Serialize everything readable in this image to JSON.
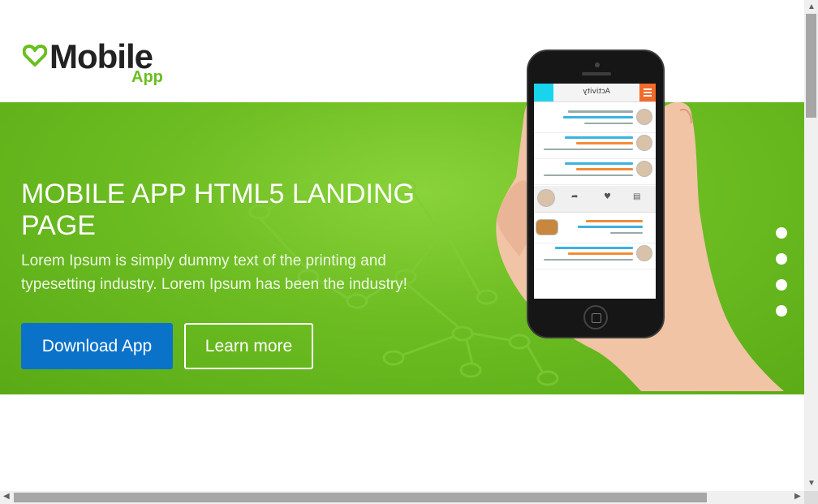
{
  "brand": {
    "name": "Mobile",
    "sub": "App",
    "accent": "#6abf1f"
  },
  "hero": {
    "headline": "MOBILE APP HTML5 LANDING PAGE",
    "lede": "Lorem Ipsum is simply dummy text of the printing and typesetting industry. Lorem Ipsum has been the industry!",
    "primary_button": "Download App",
    "secondary_button": "Learn more",
    "slide_count": 4,
    "bg_color": "#6cbc22"
  },
  "phone_screen": {
    "title": "Activity"
  },
  "colors": {
    "primary_button": "#0b72c9",
    "hero": "#6cbc22"
  }
}
